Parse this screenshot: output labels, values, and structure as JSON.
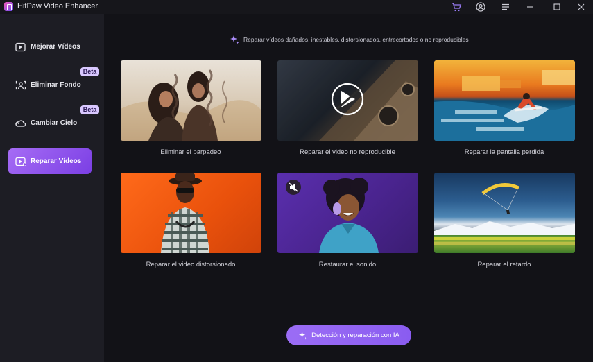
{
  "app": {
    "title": "HitPaw Video Enhancer"
  },
  "sidebar": {
    "items": [
      {
        "label": "Mejorar Vídeos",
        "icon": "video-play-icon",
        "active": false,
        "beta": ""
      },
      {
        "label": "Eliminar Fondo",
        "icon": "person-cutout-icon",
        "active": false,
        "beta": "Beta"
      },
      {
        "label": "Cambiar Cielo",
        "icon": "cloud-sky-icon",
        "active": false,
        "beta": "Beta"
      },
      {
        "label": "Reparar Vídeos",
        "icon": "video-repair-icon",
        "active": true,
        "beta": ""
      }
    ]
  },
  "main": {
    "subtitle": "Reparar vídeos dañados, inestables, distorsionados, entrecortados o no reproducibles",
    "cards": [
      {
        "label": "Eliminar el parpadeo",
        "thumbnail": "flicker-couple"
      },
      {
        "label": "Reparar el video no reproducible",
        "thumbnail": "unplayable-video"
      },
      {
        "label": "Reparar la pantalla perdida",
        "thumbnail": "surfer-glitch"
      },
      {
        "label": "Reparar el  video distorsionado",
        "thumbnail": "man-orange-background"
      },
      {
        "label": "Restaurar el sonido",
        "thumbnail": "woman-headphones-muted"
      },
      {
        "label": "Reparar el retardo",
        "thumbnail": "paraglider-lag"
      }
    ],
    "ai_button": {
      "label": "Detección y reparación con IA",
      "icon": "sparkle-icon"
    }
  },
  "colors": {
    "accent": "#9b6df5",
    "background": "#121217",
    "sidebar": "#1d1d24",
    "beta_badge": "#d9c8ff"
  }
}
